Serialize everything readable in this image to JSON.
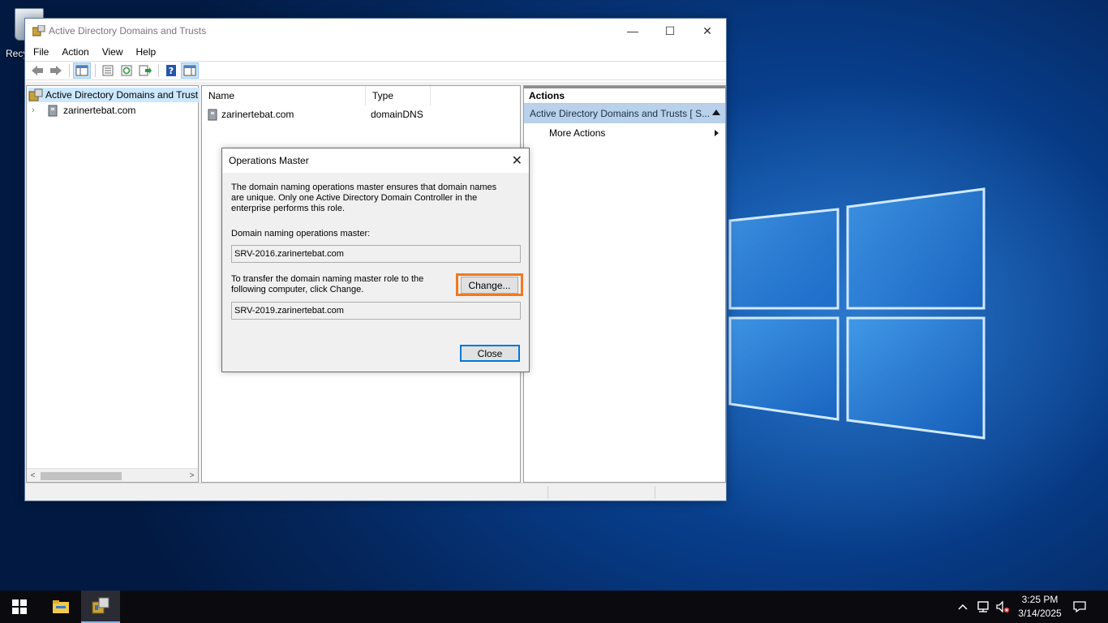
{
  "desktop": {
    "recycle_label": "Recy"
  },
  "window": {
    "title": "Active Directory Domains and Trusts",
    "controls": {
      "minimize": "—",
      "maximize": "☐",
      "close": "✕"
    },
    "menu": [
      "File",
      "Action",
      "View",
      "Help"
    ],
    "toolbar_icons": [
      "back-icon",
      "forward-icon",
      "show-hide-console-tree-icon",
      "properties-icon",
      "refresh-icon",
      "export-list-icon",
      "help-icon",
      "show-hide-action-pane-icon"
    ]
  },
  "tree": {
    "root_label": "Active Directory Domains and Trust",
    "child_label": "zarinertebat.com"
  },
  "result": {
    "columns": [
      "Name",
      "Type"
    ],
    "rows": [
      {
        "name": "zarinertebat.com",
        "type": "domainDNS"
      }
    ]
  },
  "actions": {
    "title": "Actions",
    "section": "Active Directory Domains and Trusts [ S...",
    "items": [
      "More Actions"
    ]
  },
  "dialog": {
    "title": "Operations Master",
    "description": "The domain naming operations master ensures that domain names are unique. Only one Active Directory Domain Controller in the enterprise performs this role.",
    "master_label": "Domain naming operations master:",
    "current_master": "SRV-2016.zarinertebat.com",
    "transfer_text": "To transfer the domain naming master role to the following computer, click Change.",
    "target_computer": "SRV-2019.zarinertebat.com",
    "change_button": "Change...",
    "close_button": "Close"
  },
  "taskbar": {
    "time": "3:25 PM",
    "date": "3/14/2025",
    "tray_icons": [
      "chevron-up-icon",
      "network-icon",
      "volume-muted-icon",
      "notification-icon"
    ]
  },
  "colors": {
    "highlight_border": "#f07a1e",
    "actions_section_bg": "#b9d1ea",
    "tree_selected_bg": "#cce8ff",
    "taskbar_bg": "#0a0a0f"
  }
}
